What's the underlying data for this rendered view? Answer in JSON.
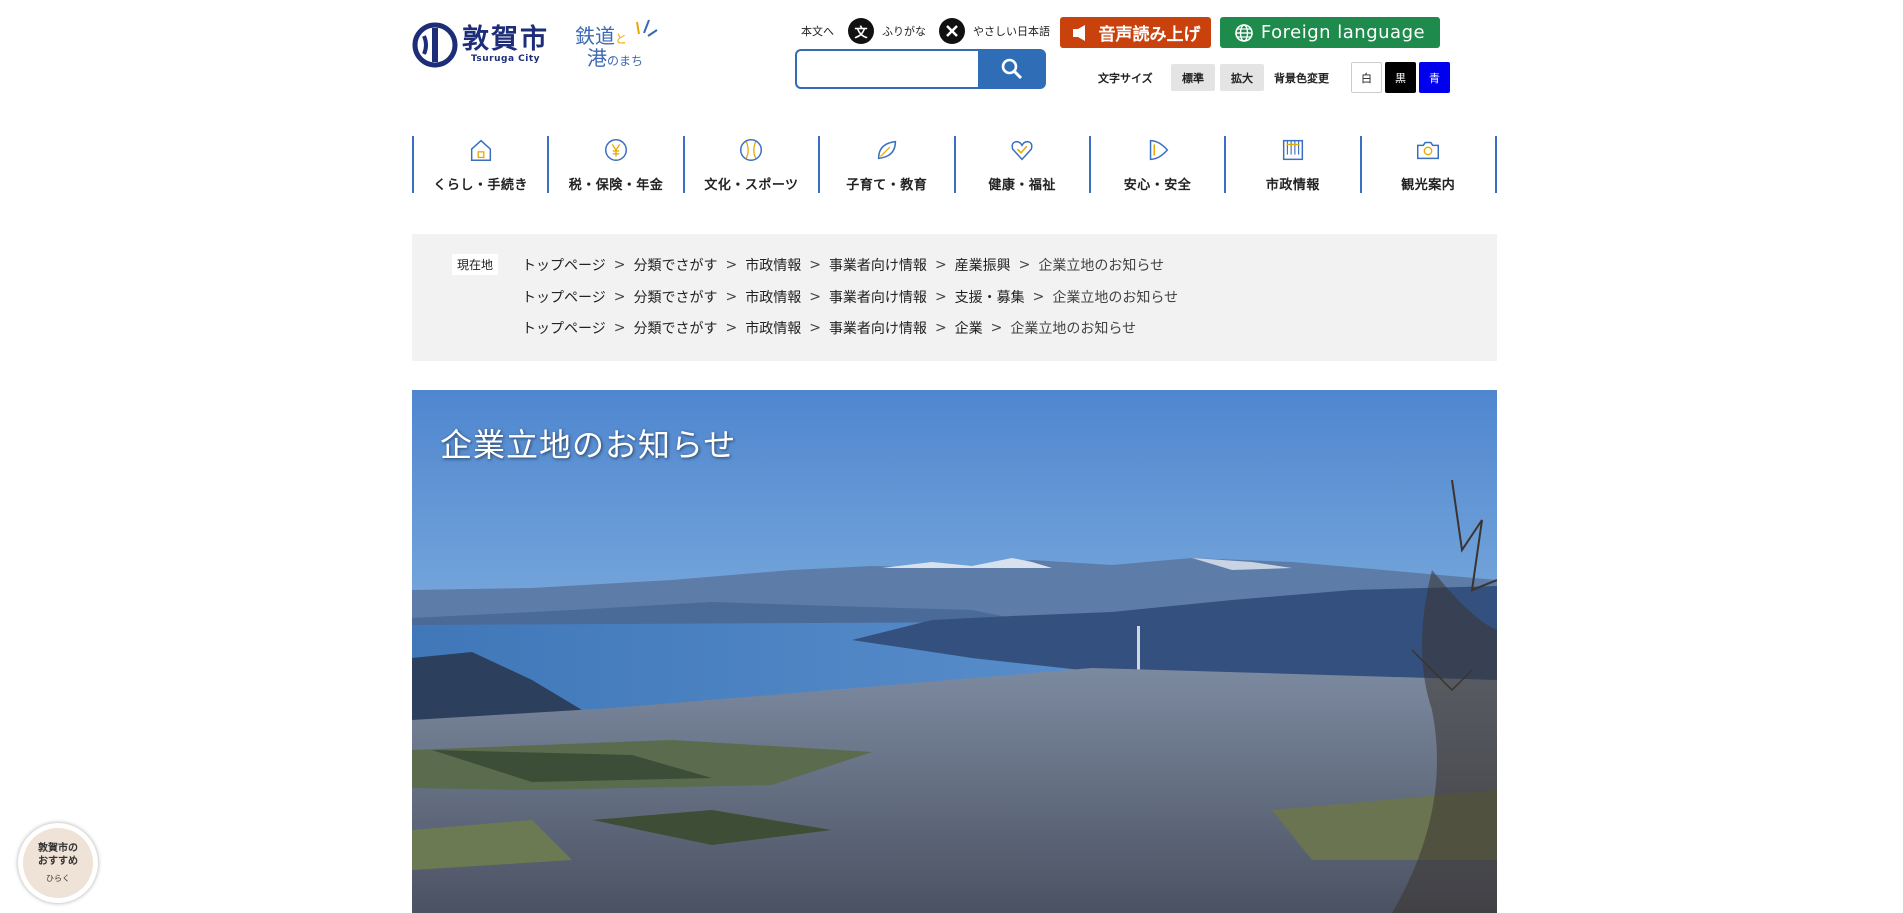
{
  "header": {
    "logo_name": "敦賀市",
    "logo_en": "Tsuruga City",
    "slogan": {
      "line1": "鉄道",
      "line1_suffix": "と",
      "line2": "港",
      "line2_suffix": "のまち"
    },
    "skip_link": "本文へ",
    "furigana_label": "ふりがな",
    "furigana_icon_char": "文",
    "easy_japanese_label": "やさしい日本語",
    "voice_button": "音声読み上げ",
    "foreign_button": "Foreign language",
    "search": {
      "value": "",
      "placeholder": ""
    },
    "text_size": {
      "label": "文字サイズ",
      "standard": "標準",
      "large": "拡大"
    },
    "bg_color": {
      "label": "背景色変更",
      "white": "白",
      "black": "黒",
      "blue": "青"
    }
  },
  "colors": {
    "brand": "#1e2d78",
    "nav_accent": "#3b6fc0",
    "voice_btn": "#c9410c",
    "foreign_btn": "#1e8a4c",
    "search_btn": "#2f6db7"
  },
  "nav": [
    {
      "label": "くらし・手続き",
      "icon": "house-icon"
    },
    {
      "label": "税・保険・年金",
      "icon": "yen-coin-icon"
    },
    {
      "label": "文化・スポーツ",
      "icon": "baseball-icon"
    },
    {
      "label": "子育て・教育",
      "icon": "leaf-icon"
    },
    {
      "label": "健康・福祉",
      "icon": "heart-check-icon"
    },
    {
      "label": "安心・安全",
      "icon": "shield-play-icon"
    },
    {
      "label": "市政情報",
      "icon": "building-icon"
    },
    {
      "label": "観光案内",
      "icon": "camera-icon"
    }
  ],
  "breadcrumb": {
    "label": "現在地",
    "rows": [
      [
        "トップページ",
        "分類でさがす",
        "市政情報",
        "事業者向け情報",
        "産業振興",
        "企業立地のお知らせ"
      ],
      [
        "トップページ",
        "分類でさがす",
        "市政情報",
        "事業者向け情報",
        "支援・募集",
        "企業立地のお知らせ"
      ],
      [
        "トップページ",
        "分類でさがす",
        "市政情報",
        "事業者向け情報",
        "企業",
        "企業立地のお知らせ"
      ]
    ]
  },
  "hero": {
    "title": "企業立地のお知らせ"
  },
  "recommend": {
    "line1": "敦賀市の",
    "line2": "おすすめ",
    "open": "ひらく"
  }
}
